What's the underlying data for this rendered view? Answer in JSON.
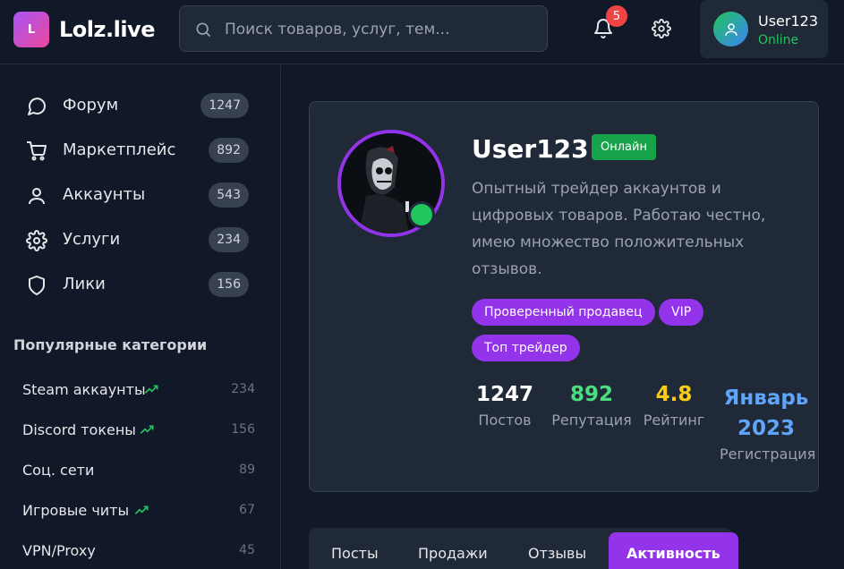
{
  "header": {
    "logo_letter": "L",
    "logo_text": "Lolz.live",
    "search_placeholder": "Поиск товаров, услуг, тем...",
    "notification_count": "5",
    "user": {
      "name": "User123",
      "status": "Online"
    }
  },
  "sidebar": {
    "nav": [
      {
        "label": "Форум",
        "count": "1247",
        "icon": "chat-bubble-icon"
      },
      {
        "label": "Маркетплейс",
        "count": "892",
        "icon": "cart-icon"
      },
      {
        "label": "Аккаунты",
        "count": "543",
        "icon": "user-icon"
      },
      {
        "label": "Услуги",
        "count": "234",
        "icon": "gear-icon"
      },
      {
        "label": "Лики",
        "count": "156",
        "icon": "shield-icon"
      }
    ],
    "popular_title": "Популярные категории",
    "categories": [
      {
        "label": "Steam аккаунты",
        "count": "234",
        "trending": true
      },
      {
        "label": "Discord токены",
        "count": "156",
        "trending": true
      },
      {
        "label": "Соц. сети",
        "count": "89",
        "trending": false
      },
      {
        "label": "Игровые читы",
        "count": "67",
        "trending": true
      },
      {
        "label": "VPN/Proxy",
        "count": "45",
        "trending": false
      }
    ]
  },
  "profile": {
    "name": "User123",
    "online_label": "Онлайн",
    "bio": "Опытный трейдер аккаунтов и цифровых товаров. Работаю честно, имею множество положительных отзывов.",
    "tags": [
      "Проверенный продавец",
      "VIP",
      "Топ трейдер"
    ],
    "stats": [
      {
        "value": "1247",
        "label": "Постов",
        "color": "#ffffff"
      },
      {
        "value": "892",
        "label": "Репутация",
        "color": "#4ade80"
      },
      {
        "value": "4.8",
        "label": "Рейтинг",
        "color": "#facc15"
      },
      {
        "value": "Январь 2023",
        "label": "Регистрация",
        "color": "#60a5fa"
      }
    ]
  },
  "tabs": [
    "Посты",
    "Продажи",
    "Отзывы",
    "Активность"
  ],
  "active_tab": "Активность",
  "colors": {
    "accent": "#9333ea",
    "online": "#22c55e",
    "background": "#111827",
    "card": "#1f2937"
  }
}
